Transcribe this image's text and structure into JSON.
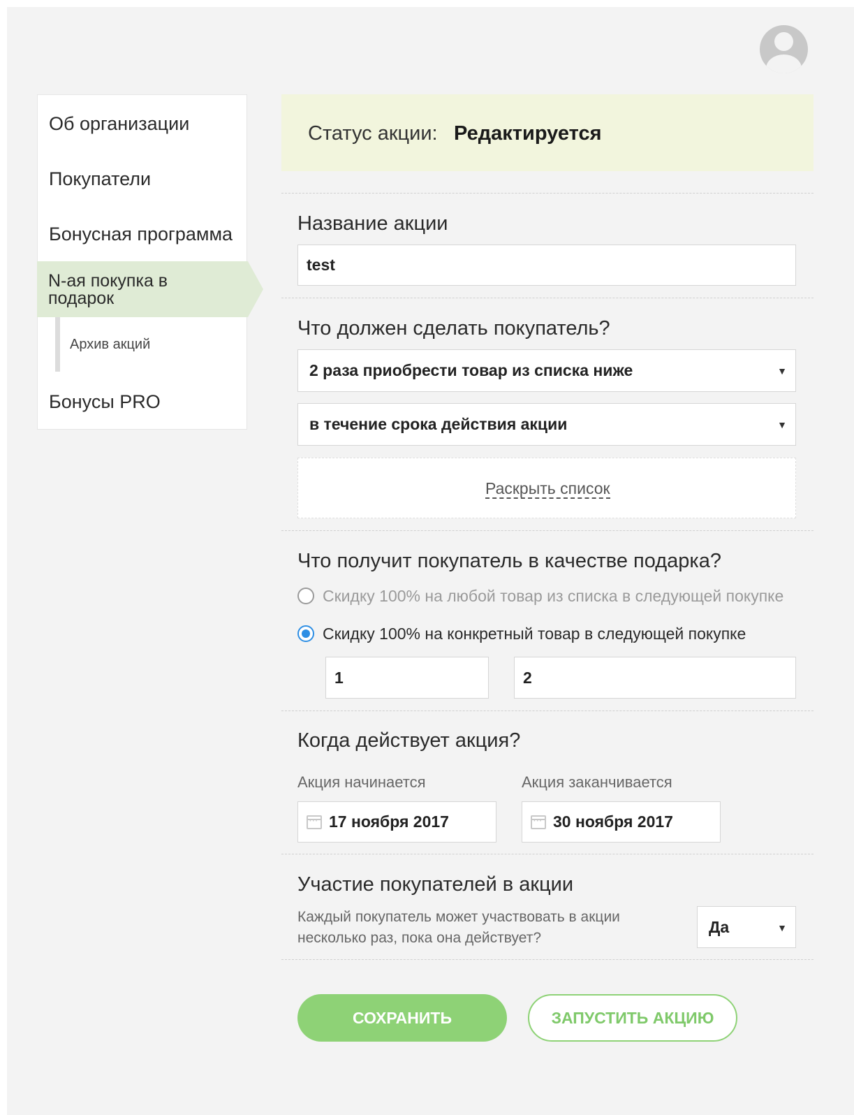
{
  "sidebar": {
    "items": [
      {
        "label": "Об организации"
      },
      {
        "label": "Покупатели"
      },
      {
        "label": "Бонусная программа"
      },
      {
        "label": "N-ая покупка в подарок"
      },
      {
        "label": "Бонусы PRO"
      }
    ],
    "sub_item": {
      "label": "Архив акций"
    }
  },
  "status": {
    "label": "Статус акции:",
    "value": "Редактируется"
  },
  "name_section": {
    "title": "Название акции",
    "value": "test"
  },
  "action_section": {
    "title": "Что должен сделать покупатель?",
    "select1": "2 раза приобрести товар из списка ниже",
    "select2": "в течение срока действия акции",
    "expand_link": "Раскрыть список"
  },
  "gift_section": {
    "title": "Что получит покупатель в качестве подарка?",
    "option1": "Скидку 100% на любой товар из списка в следующей покупке",
    "option2": "Скидку 100% на конкретный товар в следующей покупке",
    "selected": 2,
    "field1": "1",
    "field2": "2"
  },
  "period_section": {
    "title": "Когда действует акция?",
    "start_label": "Акция начинается",
    "start_value": "17 ноября 2017",
    "end_label": "Акция заканчивается",
    "end_value": "30 ноября 2017"
  },
  "participation_section": {
    "title": "Участие покупателей в акции",
    "text": "Каждый покупатель может участвовать в акции несколько раз, пока она действует?",
    "value": "Да"
  },
  "buttons": {
    "save": "СОХРАНИТЬ",
    "launch": "ЗАПУСТИТЬ АКЦИЮ"
  },
  "colors": {
    "accent_green": "#8ed276",
    "status_bg": "#f2f5dd",
    "active_nav_bg": "#dfebd5",
    "radio_blue": "#2d8ee4"
  }
}
